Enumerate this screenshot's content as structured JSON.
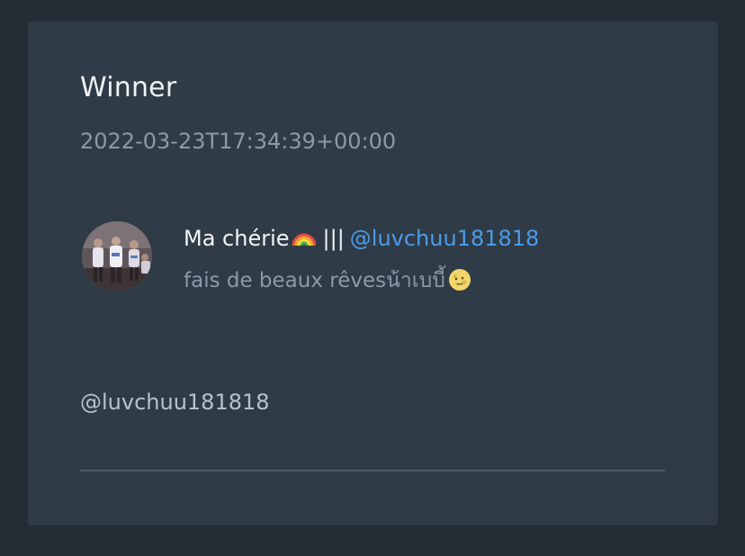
{
  "card": {
    "title": "Winner",
    "timestamp": "2022-03-23T17:34:39+00:00"
  },
  "entry": {
    "name": "Ma chérie",
    "name_icon": "rainbow-icon",
    "separator": "|||",
    "handle": "@luvchuu181818",
    "bio": "fais de beaux rêvesน้าเบบี้",
    "bio_icon": "moon-face-icon",
    "link_color": "#4b9bea"
  },
  "mention": "@luvchuu181818"
}
